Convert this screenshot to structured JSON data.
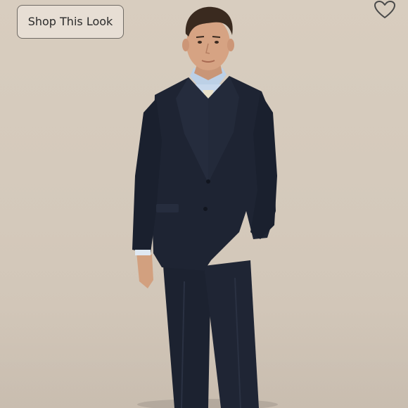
{
  "listing": {
    "shop_look_label": "Shop This Look",
    "favorite_icon": "heart-outline-icon",
    "photo_subject": "man-in-navy-suit-icon"
  },
  "colors": {
    "background": "#d6cbbd",
    "suit": "#1e2433",
    "shirt": "#bcd0e6",
    "tie": "#e9e1c9",
    "skin": "#d2a07f",
    "hair": "#3a2a1f",
    "button_border": "#6f6a64"
  }
}
